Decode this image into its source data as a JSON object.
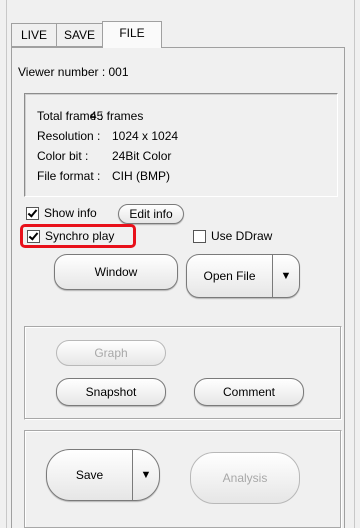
{
  "tabs": [
    {
      "label": "LIVE",
      "active": false
    },
    {
      "label": "SAVE",
      "active": false
    },
    {
      "label": "FILE",
      "active": true
    }
  ],
  "viewer_number": "Viewer number :  001",
  "info": {
    "total_frame": {
      "key": "Total frame :",
      "value": "45 frames"
    },
    "resolution": {
      "key": "Resolution :",
      "value": "1024 x 1024"
    },
    "color_bit": {
      "key": "Color bit :",
      "value": "24Bit Color"
    },
    "file_format": {
      "key": "File format :",
      "value": "CIH (BMP)"
    }
  },
  "options": {
    "show_info": {
      "label": "Show info",
      "checked": true
    },
    "edit_info_label": "Edit info",
    "synchro_play": {
      "label": "Synchro play",
      "checked": true
    },
    "use_ddraw": {
      "label": "Use DDraw",
      "checked": false
    }
  },
  "buttons": {
    "window": "Window",
    "open_file": "Open File",
    "graph": "Graph",
    "snapshot": "Snapshot",
    "comment": "Comment",
    "save": "Save",
    "analysis": "Analysis"
  },
  "icons": {
    "dropdown": "triangle-down-icon",
    "checkmark": "checkmark-icon"
  },
  "colors": {
    "highlight": "#e8101a",
    "background": "#f0f0f0",
    "disabled_text": "#a8a8a8"
  }
}
